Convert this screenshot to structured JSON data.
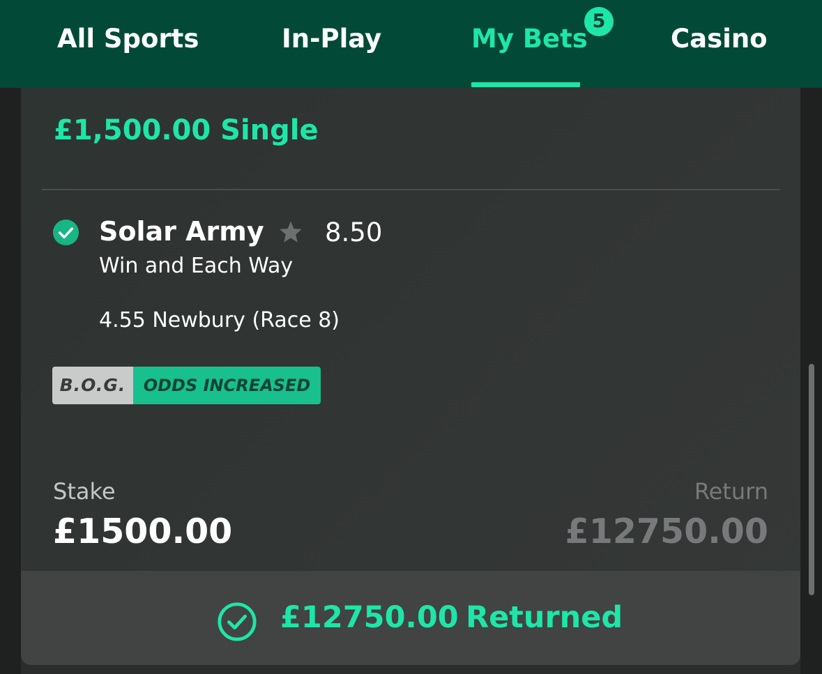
{
  "nav": {
    "tabs": [
      {
        "label": "All Sports"
      },
      {
        "label": "In-Play"
      },
      {
        "label": "My Bets",
        "badge": "5",
        "active": true
      },
      {
        "label": "Casino"
      }
    ]
  },
  "bet": {
    "title": "£1,500.00 Single",
    "selection": {
      "name": "Solar Army",
      "odds": "8.50",
      "market": "Win and Each Way",
      "event": "4.55 Newbury (Race 8)",
      "status_icon": "check-circle-icon",
      "favourite_icon": "star-icon"
    },
    "tags": {
      "bog": "B.O.G.",
      "odds_increased": "ODDS INCREASED"
    },
    "stake": {
      "label": "Stake",
      "value": "£1500.00"
    },
    "return": {
      "label": "Return",
      "value": "£12750.00"
    },
    "returned": {
      "amount": "£12750.00",
      "label": "Returned"
    }
  },
  "colors": {
    "accent": "#1ee6a8",
    "nav_background": "#024a37",
    "bog_grey": "#c9cbca",
    "odds_increased_green": "#18c08e"
  }
}
